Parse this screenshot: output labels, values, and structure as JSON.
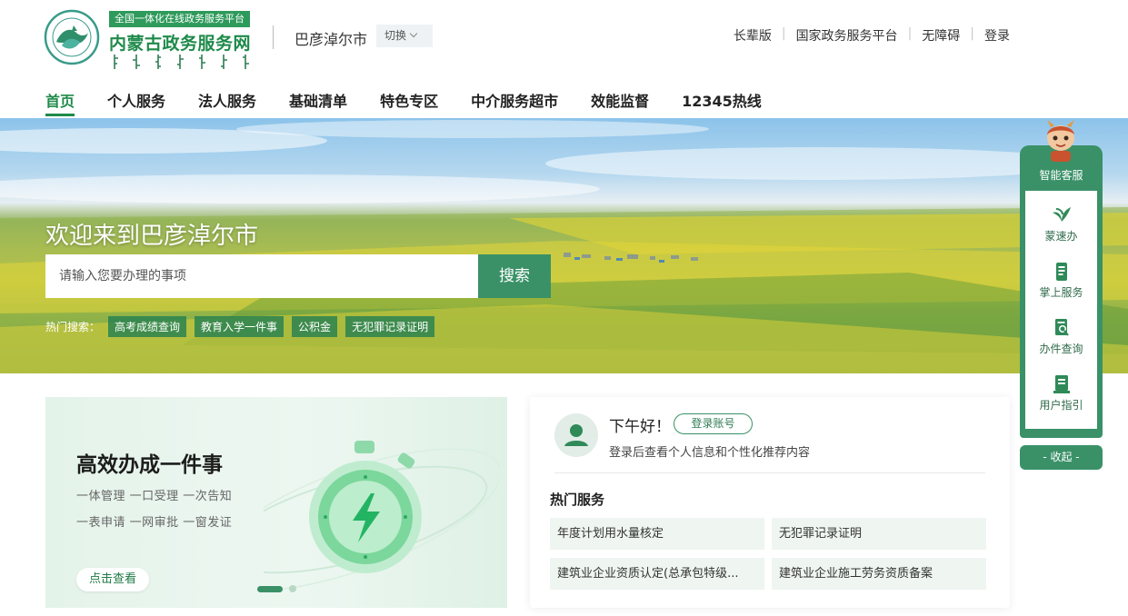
{
  "header": {
    "slogan": "全国一体化在线政务服务平台",
    "site_title": "内蒙古政务服务网",
    "city": "巴彦淖尔市",
    "switch_label": "切换",
    "top_links": [
      "长辈版",
      "国家政务服务平台",
      "无障碍",
      "登录"
    ]
  },
  "nav": {
    "items": [
      "首页",
      "个人服务",
      "法人服务",
      "基础清单",
      "特色专区",
      "中介服务超市",
      "效能监督",
      "12345热线"
    ],
    "active_index": 0
  },
  "banner": {
    "welcome": "欢迎来到巴彦淖尔市",
    "search_placeholder": "请输入您要办理的事项",
    "search_button": "搜索",
    "hot_search_label": "热门搜索：",
    "hot_tags": [
      "高考成绩查询",
      "教育入学一件事",
      "公积金",
      "无犯罪记录证明"
    ]
  },
  "promo": {
    "title": "高效办成一件事",
    "line1": "一体管理 一口受理 一次告知",
    "line2": "一表申请 一网审批 一窗发证",
    "button": "点击查看",
    "carousel_index": 0,
    "carousel_total": 2
  },
  "user_card": {
    "greeting": "下午好！",
    "login_button": "登录账号",
    "tip": "登录后查看个人信息和个性化推荐内容",
    "hot_services_title": "热门服务",
    "hot_services": [
      "年度计划用水量核定",
      "无犯罪记录证明",
      "建筑业企业资质认定(总承包特级...",
      "建筑业企业施工劳务资质备案"
    ]
  },
  "float_panel": {
    "kefu": "智能客服",
    "items": [
      {
        "label": "蒙速办",
        "icon": "mengsuban-icon"
      },
      {
        "label": "掌上服务",
        "icon": "mobile-service-icon"
      },
      {
        "label": "办件查询",
        "icon": "case-search-icon"
      },
      {
        "label": "用户指引",
        "icon": "user-guide-icon"
      }
    ],
    "collapse": "- 收起 -"
  },
  "colors": {
    "brand_green": "#1e8a4a",
    "button_green": "#3a9168",
    "tag_green": "#2a8250"
  }
}
